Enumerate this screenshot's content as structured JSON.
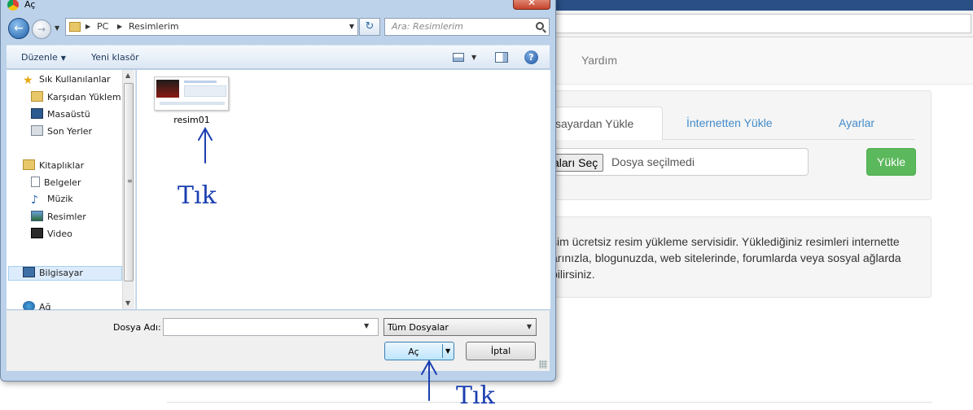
{
  "background_page": {
    "nav": {
      "help_link": "Yardım"
    },
    "upload_panel": {
      "tab_active": "sayardan Yükle",
      "tab_internet": "İnternetten Yükle",
      "tab_settings": "Ayarlar",
      "file_button": "aları Seç",
      "file_status": "Dosya seçilmedi",
      "upload_button": "Yükle",
      "upload_button_color": "#5cb85c"
    },
    "info_text": [
      "sim ücretsiz resim yükleme servisidir. Yüklediğiniz resimleri internette",
      "arınızla, blogunuzda, web sitelerinde, forumlarda veya sosyal ağlarda",
      "bilirsiniz."
    ]
  },
  "dialog": {
    "title": "Aç",
    "close_glyph": "✕",
    "breadcrumb": [
      "PC",
      "Resimlerim"
    ],
    "search_placeholder": "Ara: Resimlerim",
    "toolbar": {
      "organize": "Düzenle",
      "new_folder": "Yeni klasör"
    },
    "nav_pane": {
      "favorites": "Sık Kullanılanlar",
      "favorites_items": [
        "Karşıdan Yüklem",
        "Masaüstü",
        "Son Yerler"
      ],
      "libraries": "Kitaplıklar",
      "libraries_items": [
        "Belgeler",
        "Müzik",
        "Resimler",
        "Video"
      ],
      "computer": "Bilgisayar",
      "network": "Ağ"
    },
    "files": [
      {
        "name": "resim01"
      }
    ],
    "bottom": {
      "filename_label": "Dosya Adı:",
      "filename_value": "",
      "filetype_value": "Tüm Dosyalar",
      "open_button": "Aç",
      "cancel_button": "İptal"
    }
  },
  "annotations": {
    "label_1": "Tık",
    "label_2": "Tık",
    "ink_color": "#1b3fb0"
  }
}
